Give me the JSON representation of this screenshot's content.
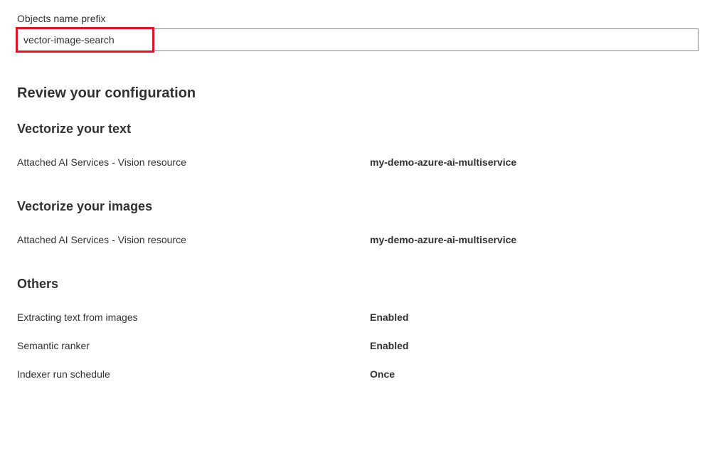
{
  "prefix_field": {
    "label": "Objects name prefix",
    "value": "vector-image-search"
  },
  "review": {
    "heading": "Review your configuration",
    "vectorize_text": {
      "heading": "Vectorize your text",
      "rows": [
        {
          "label": "Attached AI Services - Vision resource",
          "value": "my-demo-azure-ai-multiservice"
        }
      ]
    },
    "vectorize_images": {
      "heading": "Vectorize your images",
      "rows": [
        {
          "label": "Attached AI Services - Vision resource",
          "value": "my-demo-azure-ai-multiservice"
        }
      ]
    },
    "others": {
      "heading": "Others",
      "rows": [
        {
          "label": "Extracting text from images",
          "value": "Enabled"
        },
        {
          "label": "Semantic ranker",
          "value": "Enabled"
        },
        {
          "label": "Indexer run schedule",
          "value": "Once"
        }
      ]
    }
  }
}
